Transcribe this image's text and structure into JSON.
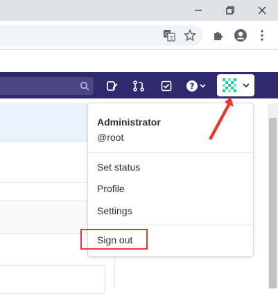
{
  "browser": {
    "window_controls": [
      {
        "name": "minimize-button",
        "glyph": "─"
      },
      {
        "name": "restore-button",
        "glyph": "❐"
      },
      {
        "name": "close-button",
        "glyph": "✕"
      }
    ],
    "toolbar_icons": [
      "translate-icon",
      "bookmark-star-icon",
      "extensions-icon",
      "profile-icon",
      "menu-icon"
    ]
  },
  "navbar": {
    "icons": [
      "search-icon",
      "issues-icon",
      "merge-requests-icon",
      "todos-icon",
      "help-icon"
    ],
    "avatar_icon": "gitlab-avatar-icon"
  },
  "user_menu": {
    "name": "Administrator",
    "username": "@root",
    "items": [
      {
        "label": "Set status"
      },
      {
        "label": "Profile"
      },
      {
        "label": "Settings"
      }
    ],
    "sign_out": "Sign out"
  },
  "annotation": {
    "highlight_color": "#e53935",
    "arrow_color": "#e53935"
  }
}
